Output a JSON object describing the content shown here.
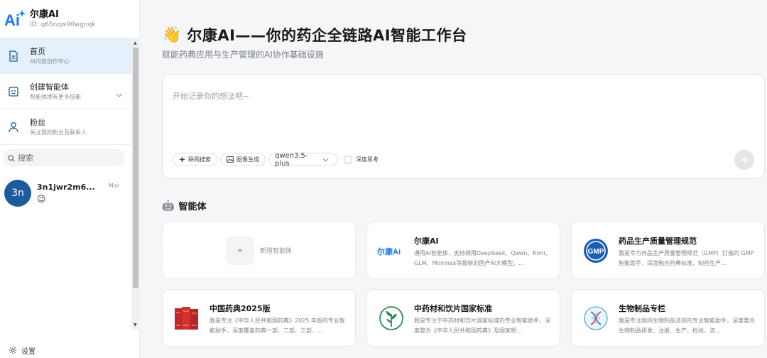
{
  "brand": {
    "name": "尔康AI",
    "id": "ID: q65nqw90wgnqk"
  },
  "nav": [
    {
      "title": "首页",
      "sub": "AI内容创作中心",
      "icon": "document-icon",
      "active": true
    },
    {
      "title": "创建智能体",
      "sub": "智能体拥有更多技能",
      "icon": "robot-icon",
      "expandable": true
    },
    {
      "title": "粉丝",
      "sub": "关注我的粉丝及联系人",
      "icon": "user-icon"
    }
  ],
  "search": {
    "placeholder": "搜索"
  },
  "conversation": {
    "avatar": "3n",
    "name": "3n1jwr2m6...",
    "emoji": "😉",
    "date": "Mar"
  },
  "settings": {
    "label": "设置"
  },
  "hero": {
    "emoji": "👋",
    "title": "尔康AI——你的药企全链路AI智能工作台",
    "subtitle": "赋能药典应用与生产管理的AI协作基础设施"
  },
  "composer": {
    "placeholder": "开始记录你的想法吧~",
    "tools": {
      "web_search": "联网搜索",
      "image_gen": "图像生成",
      "model": "qwen3.5-plus",
      "deep_think": "深度思考"
    }
  },
  "agents_section": {
    "emoji": "🤖",
    "title": "智能体"
  },
  "add_agent": {
    "plus": "+",
    "label": "新增智能体"
  },
  "agents": [
    {
      "name": "尔康AI",
      "logo_text": "尔康Ai",
      "desc": "通用AI智能体，支持调用DeepSeek、Qwen、Kimi、GLM、Minimax等最新的国产AI大模型。..."
    },
    {
      "name": "药品生产质量管理规范",
      "logo_text": "GMP",
      "desc": "我是专为药品生产质量管理规范（GMP）打造的 GMP 智能助手，深度融合药典标准、制药生产..."
    },
    {
      "name": "中国药典2025版",
      "desc": "我是专注《中华人民共和国药典》2025 年版的专业智能助手，深度覆盖药典一部、二部、三部、..."
    },
    {
      "name": "中药材和饮片国家标准",
      "desc": "我是专注于中药材和饮片国家标准的专业智能助手，深度整合《中华人民共和国药典》及国家相..."
    },
    {
      "name": "生物制品专栏",
      "desc": "我是专注国内生物制品法规的专业智能助手，深度整合生物制品研发、注册、生产、检验、流..."
    }
  ],
  "colors": {
    "accent": "#1d5b9c",
    "active_nav_bg": "#e4f0fb",
    "brand_blue": "#1677ff"
  }
}
